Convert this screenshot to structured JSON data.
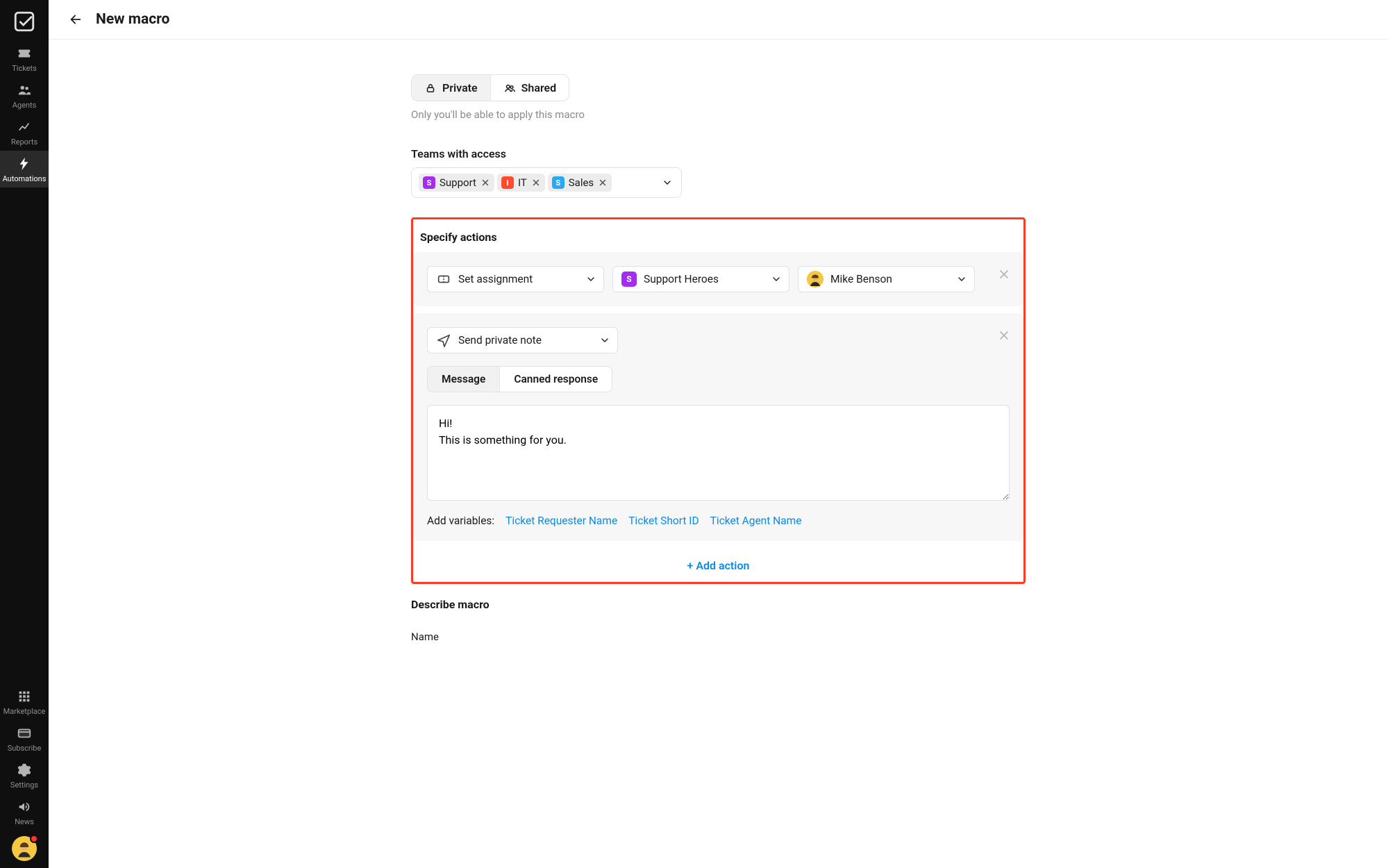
{
  "header": {
    "title": "New macro"
  },
  "sidebar": {
    "items": [
      {
        "label": "Tickets"
      },
      {
        "label": "Agents"
      },
      {
        "label": "Reports"
      },
      {
        "label": "Automations"
      }
    ],
    "bottom_items": [
      {
        "label": "Marketplace"
      },
      {
        "label": "Subscribe"
      },
      {
        "label": "Settings"
      },
      {
        "label": "News"
      }
    ]
  },
  "visibility": {
    "private_label": "Private",
    "shared_label": "Shared",
    "hint": "Only you'll be able to apply this macro"
  },
  "teams": {
    "label": "Teams with access",
    "chips": [
      {
        "name": "Support",
        "badge": "S",
        "color": "#a22cf0"
      },
      {
        "name": "IT",
        "badge": "I",
        "color": "#ff4a2e"
      },
      {
        "name": "Sales",
        "badge": "S",
        "color": "#2aa9f2"
      }
    ]
  },
  "actions": {
    "heading": "Specify actions",
    "row1": {
      "type_label": "Set assignment",
      "team_label": "Support Heroes",
      "agent_label": "Mike Benson"
    },
    "row2": {
      "type_label": "Send private note",
      "tabs": {
        "message": "Message",
        "canned": "Canned response"
      },
      "message_text": "Hi!\nThis is something for you.",
      "vars_label": "Add variables:",
      "vars": {
        "requester": "Ticket Requester Name",
        "short_id": "Ticket Short ID",
        "agent": "Ticket Agent Name"
      }
    },
    "add_label": "+ Add action"
  },
  "describe": {
    "heading": "Describe macro",
    "name_label": "Name"
  },
  "colors": {
    "link": "#0c8ae6",
    "highlight_border": "#ff3a24",
    "badge_support": "#a22cf0",
    "badge_it": "#ff4a2e",
    "badge_sales": "#2aa9f2",
    "avatar_bg": "#f5c842"
  }
}
